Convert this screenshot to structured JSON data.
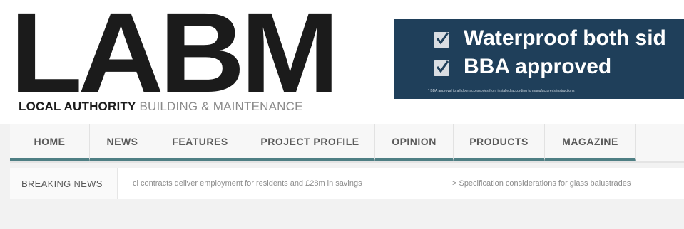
{
  "logo": {
    "main": "LABM",
    "sub_bold": "LOCAL AUTHORITY",
    "sub_light": "BUILDING & MAINTENANCE"
  },
  "ad": {
    "line1": "Waterproof both sid",
    "line2": "BBA approved",
    "fine_print": "* BBA approval to all door accessories from installed according to manufacturer's instructions",
    "background": "#1f3f5a"
  },
  "nav": {
    "items": [
      {
        "label": "HOME"
      },
      {
        "label": "NEWS"
      },
      {
        "label": "FEATURES"
      },
      {
        "label": "PROJECT PROFILE"
      },
      {
        "label": "OPINION"
      },
      {
        "label": "PRODUCTS"
      },
      {
        "label": "MAGAZINE"
      }
    ],
    "accent": "#4f7f84"
  },
  "breaking": {
    "label": "BREAKING NEWS",
    "items": [
      "ci contracts deliver employment for residents and £28m in savings",
      "> Specification considerations for glass balustrades"
    ]
  }
}
